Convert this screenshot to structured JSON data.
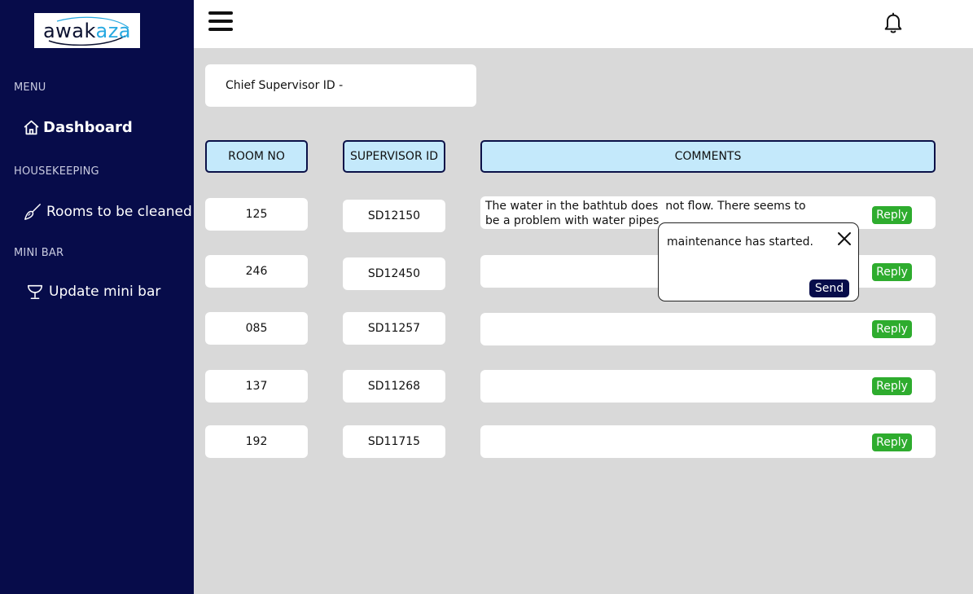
{
  "brand": {
    "part1": "awak",
    "part2": "aza"
  },
  "sidebar": {
    "sections": [
      {
        "label": "MENU"
      },
      {
        "label": "HOUSEKEEPING"
      },
      {
        "label": "MINI BAR"
      }
    ],
    "items": [
      {
        "label": "Dashboard",
        "icon": "home-icon",
        "active": true
      },
      {
        "label": "Rooms to be cleaned",
        "icon": "broom-icon"
      },
      {
        "label": "Update mini bar",
        "icon": "cocktail-glass-icon"
      }
    ]
  },
  "topbar": {
    "menu_icon": "hamburger-menu-icon",
    "notification_icon": "bell-icon"
  },
  "chief": {
    "label": "Chief Supervisor ID -"
  },
  "table": {
    "headers": [
      "ROOM NO",
      "SUPERVISOR ID",
      "COMMENTS"
    ],
    "rows": [
      {
        "room": "125",
        "supervisor": "SD12150",
        "comment": "The water in the bathtub does  not flow. There seems to\nbe a problem with water pipes",
        "reply": "Reply"
      },
      {
        "room": "246",
        "supervisor": "SD12450",
        "comment": "",
        "reply": "Reply"
      },
      {
        "room": "085",
        "supervisor": "SD11257",
        "comment": "",
        "reply": "Reply"
      },
      {
        "room": "137",
        "supervisor": "SD11268",
        "comment": "",
        "reply": "Reply"
      },
      {
        "room": "192",
        "supervisor": "SD11715",
        "comment": "",
        "reply": "Reply"
      }
    ]
  },
  "reply_popup": {
    "message": "maintenance has started.",
    "send_label": "Send"
  },
  "colors": {
    "sidebar_bg": "#070c4a",
    "header_fill": "#c4e9fb",
    "reply_green": "#2eac2e",
    "page_bg": "#d9d9d9"
  }
}
